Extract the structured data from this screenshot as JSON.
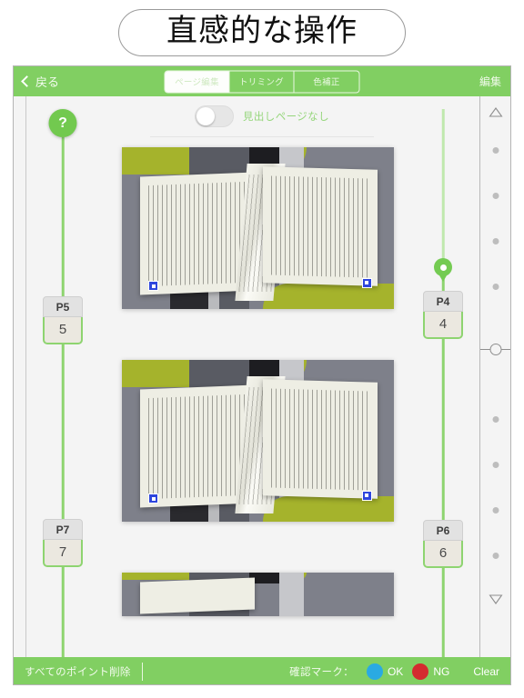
{
  "title": {
    "text": "直感的な操作"
  },
  "navbar": {
    "back_label": "戻る",
    "back_icon": "chevron-left-icon",
    "edit_label": "編集",
    "segments": [
      {
        "label": "ページ編集",
        "active": true
      },
      {
        "label": "トリミング",
        "active": false
      },
      {
        "label": "色補正",
        "active": false
      }
    ]
  },
  "toolbar": {
    "toggle_label": "見出しページなし",
    "toggle_state": "off"
  },
  "help": {
    "symbol": "?"
  },
  "left_rail": {
    "points": [
      {
        "label": "P5",
        "number": "5"
      },
      {
        "label": "P7",
        "number": "7"
      }
    ]
  },
  "right_rail": {
    "marker_icon": "map-pin-icon",
    "points": [
      {
        "label": "P4",
        "number": "4"
      },
      {
        "label": "P6",
        "number": "6"
      }
    ]
  },
  "scrubber": {
    "top_icon": "triangle-up-icon",
    "bottom_icon": "triangle-down-icon",
    "handle_icon": "circle-handle-icon",
    "dot_count_above": 4,
    "dot_count_below": 4
  },
  "pages": [
    {
      "name": "page-photo-1",
      "marker_left": "blue-square-marker",
      "marker_right": "blue-square-marker"
    },
    {
      "name": "page-photo-2",
      "marker_left": "blue-square-marker",
      "marker_right": "blue-square-marker"
    },
    {
      "name": "page-photo-3-partial"
    }
  ],
  "bottombar": {
    "delete_all_label": "すべてのポイント削除",
    "mark_label": "確認マーク：",
    "ok_label": "OK",
    "ng_label": "NG",
    "clear_label": "Clear",
    "ok_color": "#2aaae2",
    "ng_color": "#d42b2f"
  },
  "colors": {
    "brand_green": "#81cf62",
    "rail_green": "#8ed470",
    "marker_blue": "#2e46dd"
  }
}
